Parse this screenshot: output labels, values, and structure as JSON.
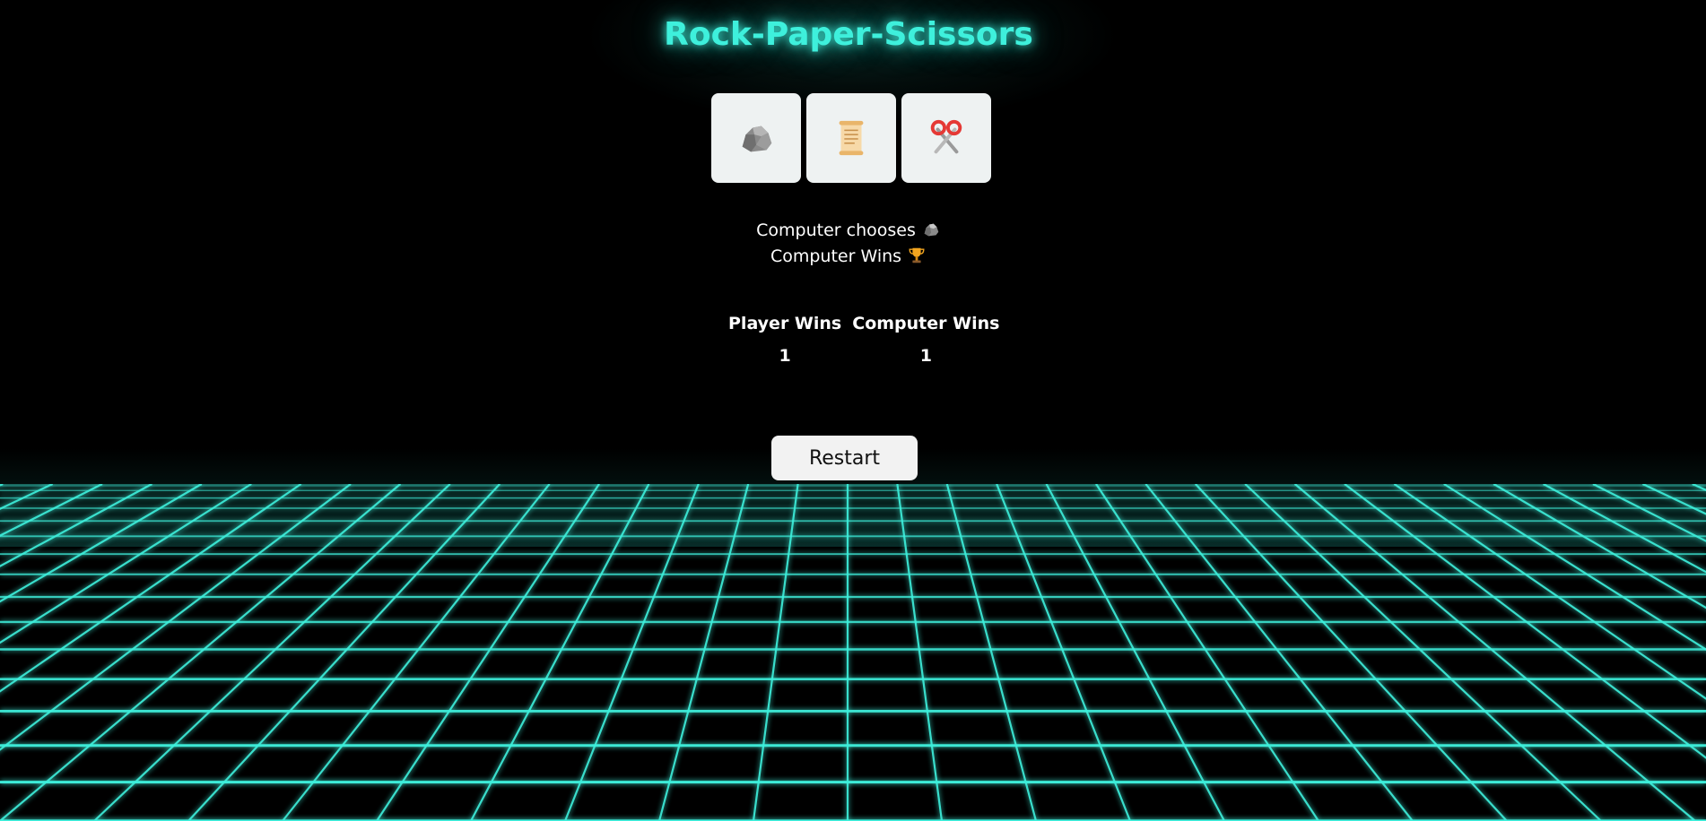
{
  "title": "Rock-Paper-Scissors",
  "choices": [
    {
      "name": "rock",
      "icon": "rock-icon"
    },
    {
      "name": "paper",
      "icon": "scroll-icon"
    },
    {
      "name": "scissors",
      "icon": "scissors-icon"
    }
  ],
  "result": {
    "computer_choice": "Computer chooses",
    "computer_choice_icon": "rock-icon",
    "outcome": "Computer Wins",
    "outcome_icon": "trophy-icon"
  },
  "score": {
    "player_label": "Player Wins",
    "computer_label": "Computer Wins",
    "player_value": "1",
    "computer_value": "1"
  },
  "restart_label": "Restart",
  "colors": {
    "accent": "#3ef0dc",
    "background": "#000000",
    "tile": "#eef2f2",
    "button": "#f2f2f2"
  }
}
